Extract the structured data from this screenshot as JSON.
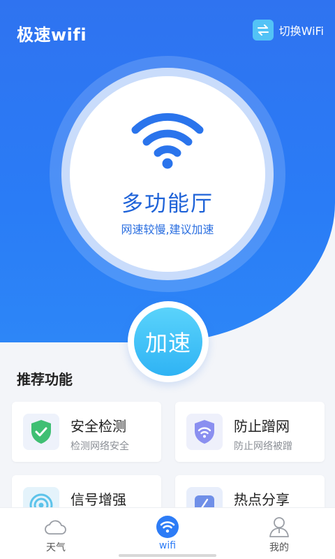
{
  "header": {
    "app_title": "极速wifi",
    "switch_label": "切换WiFi",
    "switch_icon": "swap-arrows-icon"
  },
  "status_circle": {
    "network_name": "多功能厅",
    "status_text": "网速较慢,建议加速",
    "icon": "wifi-icon"
  },
  "boost": {
    "label": "加速"
  },
  "section": {
    "title": "推荐功能"
  },
  "features": [
    {
      "title": "安全检测",
      "subtitle": "检测网络安全",
      "icon": "shield-check-icon"
    },
    {
      "title": "防止蹭网",
      "subtitle": "防止网络被蹭",
      "icon": "shield-wifi-icon"
    },
    {
      "title": "信号增强",
      "subtitle": "",
      "icon": "signal-boost-icon"
    },
    {
      "title": "热点分享",
      "subtitle": "",
      "icon": "hotspot-share-icon"
    }
  ],
  "tabbar": {
    "tabs": [
      {
        "label": "天气",
        "icon": "cloud-icon",
        "active": false
      },
      {
        "label": "wifi",
        "icon": "wifi-icon",
        "active": true
      },
      {
        "label": "我的",
        "icon": "user-icon",
        "active": false
      }
    ]
  },
  "colors": {
    "primary": "#2f73f0",
    "boost_start": "#5ad3fb",
    "boost_end": "#2fb3f4",
    "security_green": "#3fbf73",
    "antitheft_purple": "#8a8ff0",
    "active_tab": "#2d7cf6"
  }
}
